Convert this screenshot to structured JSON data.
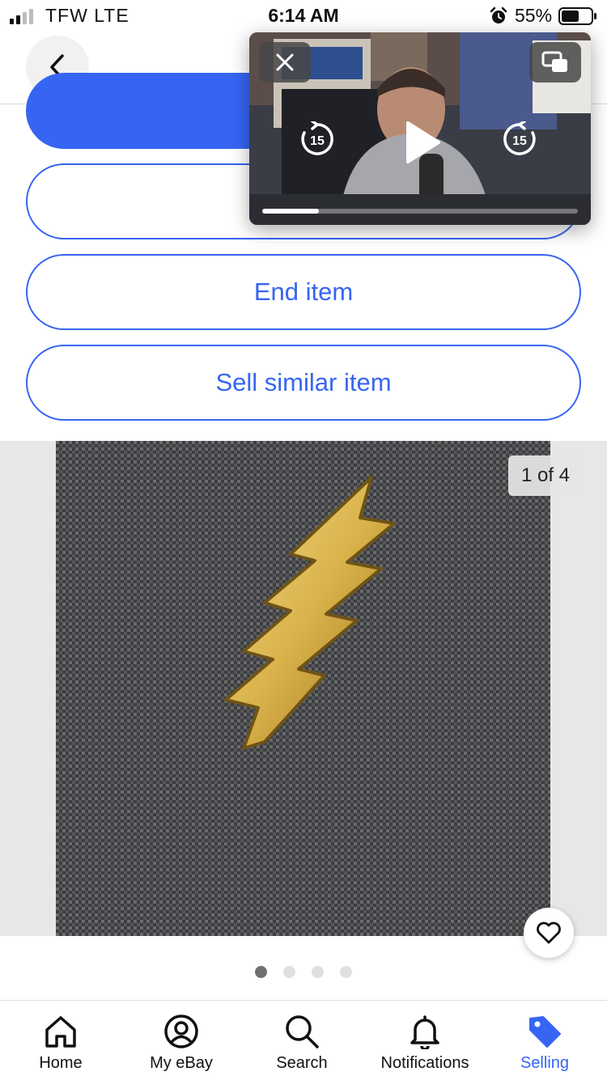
{
  "status_bar": {
    "carrier": "TFW  LTE",
    "time": "6:14 AM",
    "battery": "55%"
  },
  "actions": {
    "revise_label": "Re",
    "relist_label": "Re",
    "end_label": "End item",
    "sell_similar_label": "Sell similar item"
  },
  "gallery": {
    "counter": "1 of 4",
    "pages": 4,
    "current_page": 1
  },
  "tabs": [
    {
      "label": "Home",
      "icon": "home-icon"
    },
    {
      "label": "My eBay",
      "icon": "user-circle-icon"
    },
    {
      "label": "Search",
      "icon": "search-icon"
    },
    {
      "label": "Notifications",
      "icon": "bell-icon"
    },
    {
      "label": "Selling",
      "icon": "tag-icon",
      "selected": true
    }
  ],
  "colors": {
    "accent": "#3665f3"
  }
}
